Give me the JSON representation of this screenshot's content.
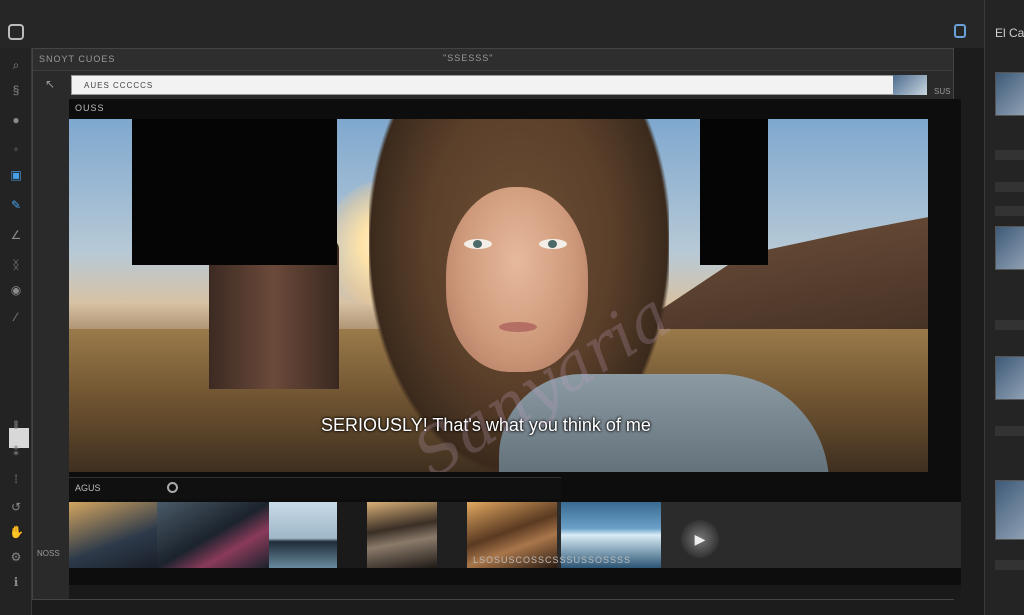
{
  "header": {
    "left_label": "SNOYT CUOES",
    "center_label": "\"SSESSS\"",
    "right_title": "El Cas"
  },
  "url_bar": {
    "text": "AUES CCCCCS",
    "corner_text": "SUS"
  },
  "viewer": {
    "label": "OUSS",
    "subtitle": "SERIOUSLY! That's what you think of me",
    "timeline_label": "AGUS",
    "watermark": "Sanyaria"
  },
  "footer": {
    "caption": "LSOSUSCOSSCSSSUSSOSSSS",
    "left_label": "NOSS"
  },
  "tools": [
    "select-tool",
    "lasso-tool",
    "brush-tool",
    "crop-tool",
    "layers-tool",
    "pen-tool",
    "text-tool",
    "circle-tool",
    "smudge-tool",
    "adjust-tool",
    "grid-tool",
    "undo-tool",
    "history-tool",
    "settings-tool"
  ],
  "colors": {
    "accent": "#4aa0e6",
    "background": "#1c1c1c",
    "subtitle": "#ffffff"
  }
}
